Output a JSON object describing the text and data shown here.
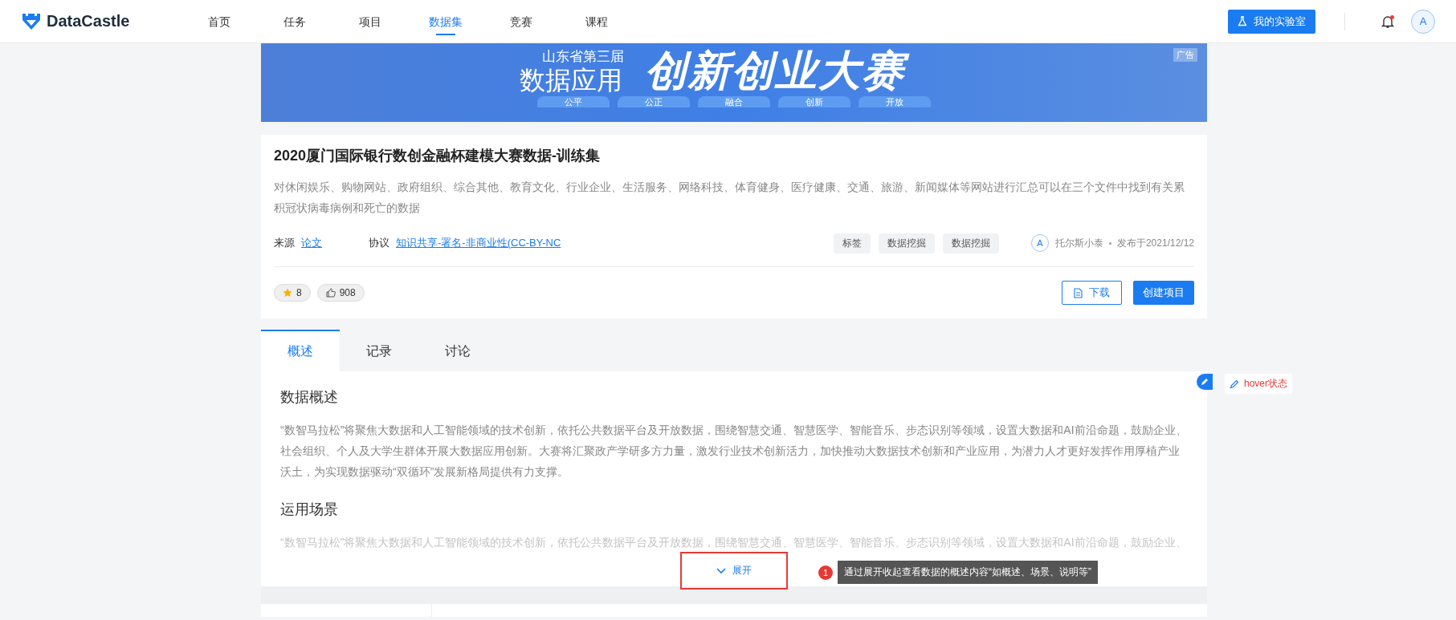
{
  "header": {
    "logo": "DataCastle",
    "nav": [
      {
        "label": "首页",
        "selected": false
      },
      {
        "label": "任务",
        "selected": false
      },
      {
        "label": "项目",
        "selected": false
      },
      {
        "label": "数据集",
        "selected": true
      },
      {
        "label": "竞赛",
        "selected": false
      },
      {
        "label": "课程",
        "selected": false
      }
    ],
    "lab_button": "我的实验室",
    "notification_dot": true,
    "avatar": "A"
  },
  "banner": {
    "subtitle": "山东省第三届",
    "title_left": "数据应用",
    "title_right": "创新创业大赛",
    "ad_label": "广告",
    "pills": [
      "公平",
      "公正",
      "融合",
      "创新",
      "开放"
    ]
  },
  "dataset": {
    "title": "2020厦门国际银行数创金融杯建模大赛数据-训练集",
    "description": "对休闲娱乐、购物网站、政府组织、综合其他、教育文化、行业企业、生活服务、网络科技、体育健身、医疗健康、交通、旅游、新闻媒体等网站进行汇总可以在三个文件中找到有关累积冠状病毒病例和死亡的数据",
    "source_label": "来源",
    "source_link": "论文",
    "license_label": "协议",
    "license_link": "知识共享-署名-非商业性(CC-BY-NC",
    "tags": [
      "标签",
      "数据挖掘",
      "数据挖掘"
    ],
    "author_avatar": "A",
    "author": "托尔斯小泰",
    "published": "发布于2021/12/12",
    "stars": "8",
    "likes": "908",
    "download_button": "下载",
    "create_button": "创建项目"
  },
  "tabs": [
    {
      "label": "概述",
      "selected": true
    },
    {
      "label": "记录",
      "selected": false
    },
    {
      "label": "讨论",
      "selected": false
    }
  ],
  "sections": [
    {
      "heading": "数据概述",
      "paragraph": "“数智马拉松”将聚焦大数据和人工智能领域的技术创新，依托公共数据平台及开放数据，围绕智慧交通、智慧医学、智能音乐、步态识别等领域，设置大数据和AI前沿命题，鼓励企业、社会组织、个人及大学生群体开展大数据应用创新。大赛将汇聚政产学研多方力量，激发行业技术创新活力，加快推动大数据技术创新和产业应用，为潜力人才更好发挥作用厚植产业沃土，为实现数据驱动“双循环”发展新格局提供有力支撑。",
      "faded": false
    },
    {
      "heading": "运用场景",
      "paragraph": "“数智马拉松”将聚焦大数据和人工智能领域的技术创新，依托公共数据平台及开放数据，围绕智慧交通、智慧医学、智能音乐、步态识别等领域，设置大数据和AI前沿命题，鼓励企业、",
      "faded": true
    }
  ],
  "expand_button": "展开",
  "hover_label": "hover状态",
  "annotation": {
    "number": "1",
    "text": "通过展开收起查看数据的概述内容“如概述、场景、说明等”"
  }
}
